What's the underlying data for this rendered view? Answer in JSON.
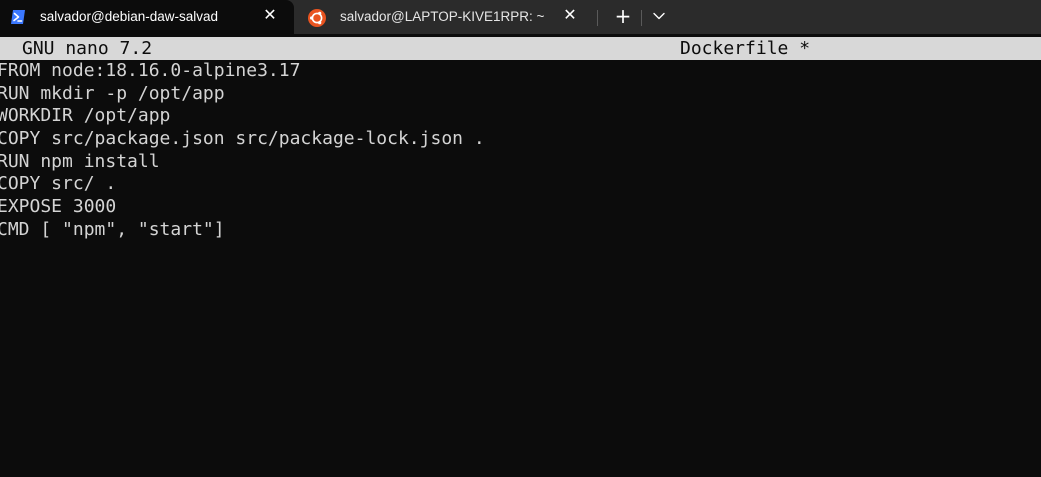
{
  "colors": {
    "terminal_bg": "#0c0c0c",
    "tabbar_bg": "#2b2b2b",
    "header_bg": "#d8d8d8",
    "text": "#d4d4d4",
    "powershell_blue": "#3b78ff",
    "ubuntu_orange": "#e95420"
  },
  "tabs": [
    {
      "title": "salvador@debian-daw-salvad",
      "icon": "powershell-icon",
      "active": true,
      "close_glyph": "✕"
    },
    {
      "title": "salvador@LAPTOP-KIVE1RPR: ~",
      "icon": "ubuntu-icon",
      "active": false,
      "close_glyph": "✕"
    }
  ],
  "tabbar": {
    "new_tab_glyph": "+",
    "dropdown_icon": "chevron-down-icon"
  },
  "nano": {
    "version": "GNU nano 7.2",
    "filename": "Dockerfile *"
  },
  "editor": {
    "lines": [
      "FROM node:18.16.0-alpine3.17",
      "RUN mkdir -p /opt/app",
      "WORKDIR /opt/app",
      "COPY src/package.json src/package-lock.json .",
      "RUN npm install",
      "COPY src/ .",
      "EXPOSE 3000",
      "CMD [ \"npm\", \"start\"]"
    ]
  }
}
